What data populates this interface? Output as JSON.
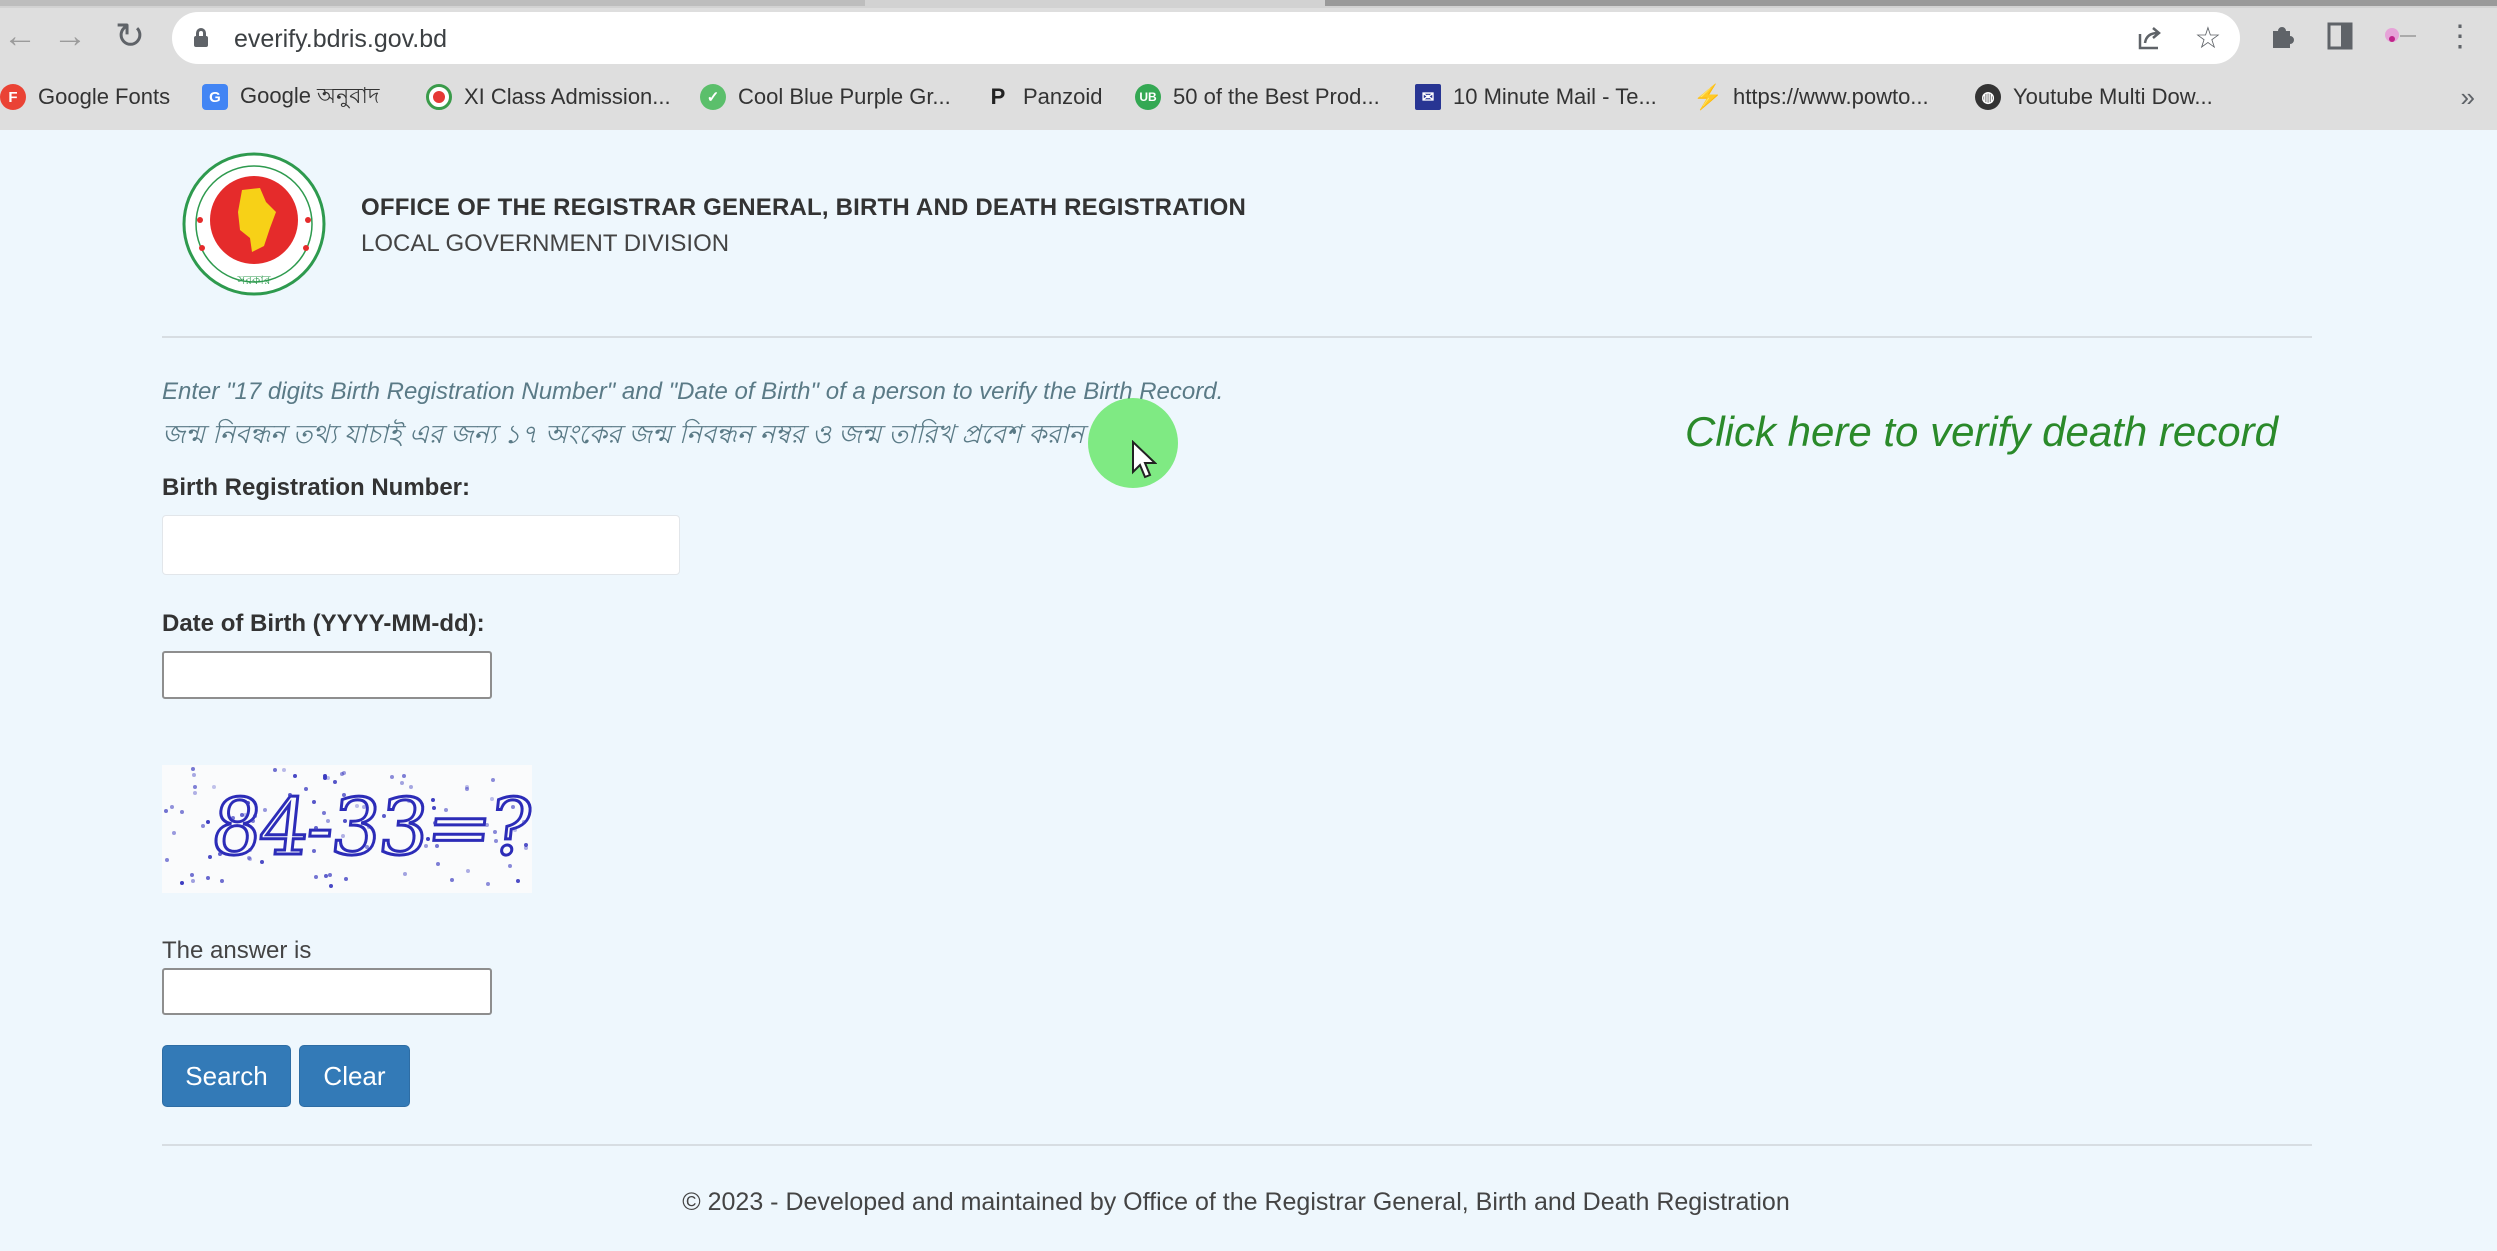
{
  "browser": {
    "url": "everify.bdris.gov.bd",
    "bookmarks": [
      {
        "label": "Google Fonts",
        "icon": "google-fonts-icon",
        "color": "#ea4335",
        "glyph": "F"
      },
      {
        "label": "Google অনুবাদ",
        "icon": "google-translate-icon",
        "color": "#4285f4",
        "glyph": "G"
      },
      {
        "label": "XI Class Admission...",
        "icon": "bd-govt-seal-icon",
        "color": "#e53935",
        "glyph": "●"
      },
      {
        "label": "Cool Blue Purple Gr...",
        "icon": "cool-gradient-icon",
        "color": "#4caf50",
        "glyph": "✓"
      },
      {
        "label": "Panzoid",
        "icon": "panzoid-icon",
        "color": "#222222",
        "glyph": "P"
      },
      {
        "label": "50 of the Best Prod...",
        "icon": "ub-icon",
        "color": "#34a853",
        "glyph": "U"
      },
      {
        "label": "10 Minute Mail - Te...",
        "icon": "ten-minute-mail-icon",
        "color": "#283593",
        "glyph": "✉"
      },
      {
        "label": "https://www.powto...",
        "icon": "powtoon-icon",
        "color": "#3d5afe",
        "glyph": "⚡"
      },
      {
        "label": "Youtube Multi Dow...",
        "icon": "globe-icon",
        "color": "#333333",
        "glyph": "◍"
      }
    ],
    "more_bookmarks": "»"
  },
  "header": {
    "title": "OFFICE OF THE REGISTRAR GENERAL, BIRTH AND DEATH REGISTRATION",
    "subtitle": "LOCAL GOVERNMENT DIVISION"
  },
  "instructions": {
    "english": "Enter \"17 digits Birth Registration Number\" and \"Date of Birth\" of a person to verify the Birth Record.",
    "bangla": "জন্ম নিবন্ধন তথ্য যাচাই এর জন্য ১৭ অংকের জন্ম নিবন্ধন নম্বর ও জন্ম তারিখ প্রবেশ করান"
  },
  "death_link": "Click here to verify death record",
  "form": {
    "brn_label": "Birth Registration Number:",
    "brn_value": "",
    "dob_label": "Date of Birth (YYYY-MM-dd):",
    "dob_value": "",
    "captcha_text": "84-33=?",
    "answer_label": "The answer is",
    "answer_value": "",
    "search_label": "Search",
    "clear_label": "Clear"
  },
  "footer": "© 2023 - Developed and maintained by Office of the Registrar General, Birth and Death Registration",
  "colors": {
    "page_bg": "#eef7fd",
    "button": "#337ab7",
    "death_link": "#2a8a2a",
    "instruction": "#5a7a86"
  }
}
